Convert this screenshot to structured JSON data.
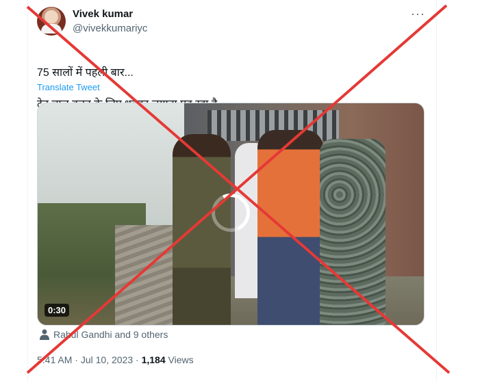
{
  "tweet": {
    "display_name": "Vivek kumar",
    "handle": "@vivekkumariyc",
    "more_label": "···",
    "text_line1": "75 सालों में पहली बार...",
    "text_line2": "ट्रेन चालू करन के लिए धक्का लगाना पड़ रहा है..",
    "translate_label": "Translate Tweet",
    "video_duration": "0:30",
    "tagged_text": "Rahul Gandhi and 9 others",
    "time": "5:41 AM",
    "date": "Jul 10, 2023",
    "views_count": "1,184",
    "views_label": "Views",
    "separator": "·"
  },
  "icons": {
    "avatar": "avatar",
    "more": "more-icon",
    "tagged": "person-icon",
    "loading": "loading-spinner-icon"
  },
  "colors": {
    "link": "#1d9bf0",
    "secondary_text": "#536471",
    "cross_overlay": "#e53935"
  }
}
